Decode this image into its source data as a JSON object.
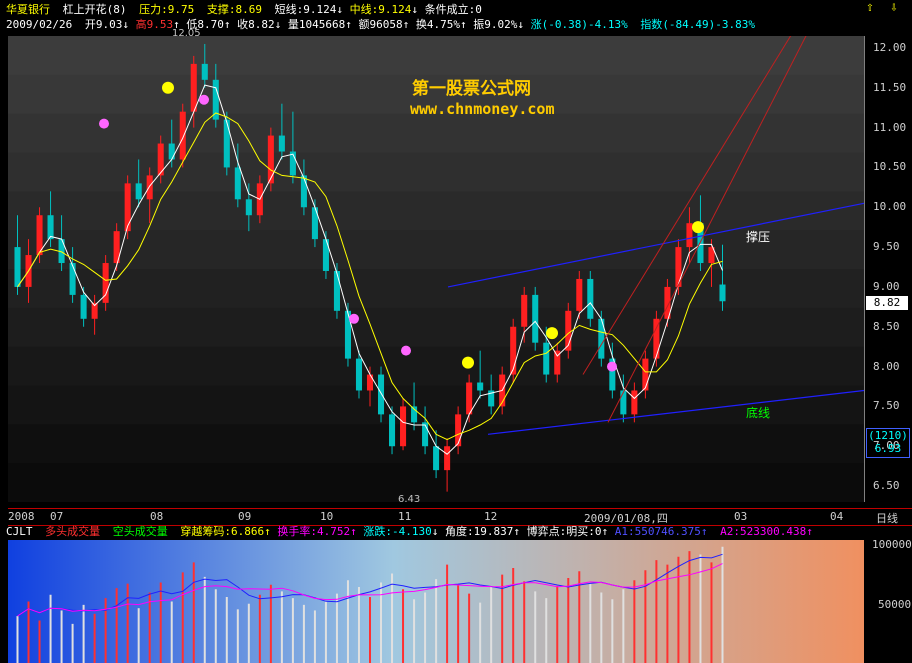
{
  "header": {
    "stock": "华夏银行",
    "formula": "杠上开花(8)",
    "pressure_label": "压力:",
    "pressure": "9.75",
    "support_label": "支撑:",
    "support": "8.69",
    "short_label": "短线:",
    "short": "9.124",
    "mid_label": "中线:",
    "mid": "9.124",
    "cond_label": "条件成立:",
    "cond": "0"
  },
  "quote": {
    "date": "2009/02/26",
    "open_label": "开",
    "open": "9.03",
    "high_label": "高",
    "high": "9.53",
    "low_label": "低",
    "low": "8.70",
    "close_label": "收",
    "close": "8.82",
    "vol_label": "量",
    "vol": "1045668",
    "amount_label": "额",
    "amount": "96058",
    "turn_label": "换",
    "turn": "4.75%",
    "amp_label": "振",
    "amp": "9.02%",
    "change_label": "涨",
    "change": "(-0.38)-4.13%",
    "index_label": "指数",
    "index": "(-84.49)-3.83%"
  },
  "watermark": {
    "cn": "第一股票公式网",
    "url": "www.chnmoney.com"
  },
  "labels": {
    "resistance": "撑压",
    "bottom": "底线",
    "hi_mark": "12.05",
    "lo_mark": "6.43"
  },
  "price_boxes": {
    "current": "8.82",
    "days": "(1210)",
    "cursor_price": "6.93"
  },
  "x_axis": {
    "labels": [
      "2008",
      "07",
      "08",
      "09",
      "10",
      "11",
      "12",
      "2009/01/08,四",
      "03",
      "04"
    ],
    "unit": "日线"
  },
  "indicator": {
    "name": "CJLT",
    "many": "多头成交量",
    "empty": "空头成交量",
    "chip_label": "穿越筹码:",
    "chip": "6.866",
    "hs_label": "换手率:",
    "hs": "4.752",
    "zd_label": "涨跌:",
    "zd": "-4.130",
    "angle_label": "角度:",
    "angle": "19.837",
    "game_label": "博弈点:",
    "game_sep": "明买:",
    "game": "0",
    "a1": "A1:550746.375",
    "a2": "A2:523300.438"
  },
  "colors": {
    "up": "#ff2020",
    "down": "#00c0c0",
    "short": "#ffffff",
    "mid": "#ffff00",
    "channel": "#2020ff"
  },
  "chart_data": {
    "type": "bar",
    "title": "",
    "ylim": [
      6.3,
      12.15
    ],
    "yticks": [
      "12.00",
      "11.50",
      "11.00",
      "10.50",
      "10.00",
      "9.50",
      "9.00",
      "8.50",
      "8.00",
      "7.50",
      "7.00",
      "6.50"
    ],
    "ytick_values": [
      12.0,
      11.5,
      11.0,
      10.5,
      10.0,
      9.5,
      9.0,
      8.5,
      8.0,
      7.5,
      7.0,
      6.5
    ],
    "ohlc": [
      [
        9.5,
        9.9,
        8.9,
        9.0
      ],
      [
        9.0,
        9.6,
        8.8,
        9.4
      ],
      [
        9.4,
        10.0,
        9.3,
        9.9
      ],
      [
        9.9,
        10.2,
        9.5,
        9.6
      ],
      [
        9.6,
        9.9,
        9.2,
        9.3
      ],
      [
        9.3,
        9.5,
        8.8,
        8.9
      ],
      [
        8.9,
        9.0,
        8.5,
        8.6
      ],
      [
        8.6,
        8.9,
        8.4,
        8.8
      ],
      [
        8.8,
        9.4,
        8.7,
        9.3
      ],
      [
        9.3,
        9.8,
        9.2,
        9.7
      ],
      [
        9.7,
        10.4,
        9.6,
        10.3
      ],
      [
        10.3,
        10.6,
        10.0,
        10.1
      ],
      [
        10.1,
        10.5,
        9.8,
        10.4
      ],
      [
        10.4,
        10.9,
        10.3,
        10.8
      ],
      [
        10.8,
        11.1,
        10.5,
        10.6
      ],
      [
        10.6,
        11.3,
        10.5,
        11.2
      ],
      [
        11.2,
        11.9,
        11.0,
        11.8
      ],
      [
        11.8,
        12.05,
        11.5,
        11.6
      ],
      [
        11.6,
        11.8,
        11.0,
        11.1
      ],
      [
        11.1,
        11.2,
        10.4,
        10.5
      ],
      [
        10.5,
        10.8,
        10.0,
        10.1
      ],
      [
        10.1,
        10.3,
        9.7,
        9.9
      ],
      [
        9.9,
        10.4,
        9.8,
        10.3
      ],
      [
        10.3,
        11.0,
        10.2,
        10.9
      ],
      [
        10.9,
        11.3,
        10.6,
        10.7
      ],
      [
        10.7,
        11.2,
        10.3,
        10.4
      ],
      [
        10.4,
        10.6,
        9.9,
        10.0
      ],
      [
        10.0,
        10.1,
        9.5,
        9.6
      ],
      [
        9.6,
        9.7,
        9.1,
        9.2
      ],
      [
        9.2,
        9.3,
        8.6,
        8.7
      ],
      [
        8.7,
        8.8,
        8.0,
        8.1
      ],
      [
        8.1,
        8.2,
        7.6,
        7.7
      ],
      [
        7.7,
        8.0,
        7.5,
        7.9
      ],
      [
        7.9,
        8.0,
        7.3,
        7.4
      ],
      [
        7.4,
        7.5,
        6.9,
        7.0
      ],
      [
        7.0,
        7.6,
        6.95,
        7.5
      ],
      [
        7.5,
        7.8,
        7.2,
        7.3
      ],
      [
        7.3,
        7.5,
        6.9,
        7.0
      ],
      [
        7.0,
        7.2,
        6.6,
        6.7
      ],
      [
        6.7,
        7.1,
        6.43,
        7.0
      ],
      [
        7.0,
        7.5,
        6.9,
        7.4
      ],
      [
        7.4,
        7.9,
        7.3,
        7.8
      ],
      [
        7.8,
        8.2,
        7.6,
        7.7
      ],
      [
        7.7,
        7.9,
        7.4,
        7.5
      ],
      [
        7.5,
        8.0,
        7.4,
        7.9
      ],
      [
        7.9,
        8.6,
        7.8,
        8.5
      ],
      [
        8.5,
        9.0,
        8.3,
        8.9
      ],
      [
        8.9,
        9.0,
        8.2,
        8.3
      ],
      [
        8.3,
        8.5,
        7.8,
        7.9
      ],
      [
        7.9,
        8.3,
        7.8,
        8.2
      ],
      [
        8.2,
        8.8,
        8.1,
        8.7
      ],
      [
        8.7,
        9.2,
        8.6,
        9.1
      ],
      [
        9.1,
        9.2,
        8.5,
        8.6
      ],
      [
        8.6,
        8.7,
        8.0,
        8.1
      ],
      [
        8.1,
        8.3,
        7.6,
        7.7
      ],
      [
        7.7,
        7.9,
        7.3,
        7.4
      ],
      [
        7.4,
        7.8,
        7.3,
        7.7
      ],
      [
        7.7,
        8.2,
        7.6,
        8.1
      ],
      [
        8.1,
        8.7,
        8.0,
        8.6
      ],
      [
        8.6,
        9.1,
        8.5,
        9.0
      ],
      [
        9.0,
        9.6,
        8.9,
        9.5
      ],
      [
        9.5,
        10.0,
        9.3,
        9.8
      ],
      [
        9.8,
        10.15,
        9.2,
        9.3
      ],
      [
        9.3,
        9.6,
        9.0,
        9.5
      ],
      [
        9.03,
        9.53,
        8.7,
        8.82
      ]
    ],
    "volumes": [
      42,
      55,
      38,
      61,
      47,
      35,
      52,
      44,
      58,
      67,
      71,
      49,
      63,
      72,
      55,
      81,
      90,
      77,
      66,
      59,
      48,
      53,
      61,
      70,
      64,
      58,
      52,
      47,
      55,
      62,
      74,
      68,
      59,
      72,
      80,
      66,
      57,
      63,
      75,
      88,
      70,
      62,
      54,
      68,
      79,
      85,
      73,
      64,
      58,
      69,
      76,
      82,
      71,
      63,
      57,
      66,
      74,
      83,
      92,
      88,
      95,
      100,
      97,
      90,
      104
    ]
  }
}
